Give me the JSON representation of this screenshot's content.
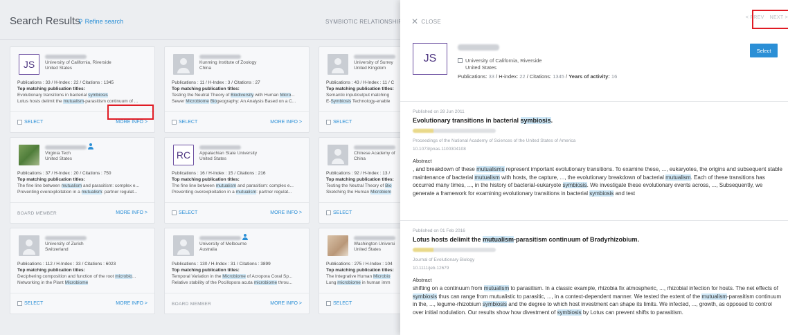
{
  "header": {
    "title": "Search Results",
    "refine": "Refine search",
    "breadcrumb": "SYMBIOTIC RELATIONSHIPS A"
  },
  "cards": [
    {
      "initials": "JS",
      "inst": "University of California, Riverside",
      "country": "United States",
      "stats": "Publications : 33 / H-Index : 22 / Citations : 1345",
      "tmpt": "Top matching publication titles:",
      "pub1": "Evolutionary transitions in bacterial symbiosis",
      "pub2": "Lotus hosts delimit the mutualism-parasitism continuum of ...",
      "select": "SELECT",
      "more": "MORE INFO >"
    },
    {
      "inst": "Kunming Institute of Zoology",
      "country": "China",
      "stats": "Publications : 11 / H-Index : 3 / Citations : 27",
      "tmpt": "Top matching publication titles:",
      "pub1": "Testing the Neutral Theory of Biodiversity with Human Micro...",
      "pub2": "Sewer Microbiome Biogeography: An Analysis Based on a C...",
      "select": "SELECT",
      "more": "MORE INFO >"
    },
    {
      "inst": "University of Surrey",
      "country": "United Kingdom",
      "stats": "Publications : 43 / H-Index : 11 / C",
      "tmpt": "Top matching publication titles:",
      "pub1": "Semantic input/output matching",
      "pub2": "E-Symbiosis Technology-enable",
      "select": "SELECT"
    },
    {
      "inst": "Virginia Tech",
      "country": "United States",
      "stats": "Publications : 37 / H-Index : 20 / Citations : 750",
      "tmpt": "Top matching publication titles:",
      "pub1": "The fine line between mutualism and parasitism: complex e...",
      "pub2": "Preventing overexploitation in a mutualism: partner regulat...",
      "board": "BOARD MEMBER",
      "more": "MORE INFO >"
    },
    {
      "initials": "RC",
      "inst": "Appalachian State University",
      "country": "United States",
      "stats": "Publications : 16 / H-Index : 15 / Citations : 216",
      "tmpt": "Top matching publication titles:",
      "pub1": "The fine line between mutualism and parasitism: complex e...",
      "pub2": "Preventing overexploitation in a mutualism: partner regulat...",
      "select": "SELECT",
      "more": "MORE INFO >"
    },
    {
      "inst": "Chinese Academy of",
      "country": "China",
      "stats": "Publications : 92 / H-Index : 13 /",
      "tmpt": "Top matching publication titles:",
      "pub1": "Testing the Neutral Theory of Bio",
      "pub2": "Sketching the Human Microbiom",
      "select": "SELECT"
    },
    {
      "inst": "University of Zurich",
      "country": "Switzerland",
      "stats": "Publications : 112 / H-Index : 33 / Citations : 6023",
      "tmpt": "Top matching publication titles:",
      "pub1": "Deciphering composition and function of the root microbio...",
      "pub2": "Networking in the Plant Microbiome",
      "select": "SELECT",
      "more": "MORE INFO >"
    },
    {
      "inst": "University of Melbourne",
      "country": "Australia",
      "stats": "Publications : 130 / H-Index : 31 / Citations : 3899",
      "tmpt": "Top matching publication titles:",
      "pub1": "Temporal Variation in the Microbiome of Acropora Coral Sp...",
      "pub2": "Relative stability of the Pocillopora acuta microbiome throu...",
      "board": "BOARD MEMBER",
      "more": "MORE INFO >"
    },
    {
      "inst": "Washington Universi",
      "country": "United States",
      "stats": "Publications : 275 / H-Index : 104",
      "tmpt": "Top matching publication titles:",
      "pub1": "The Integrative Human Microbio",
      "pub2": "Lung microbiome in human imm",
      "select": "SELECT"
    }
  ],
  "panel": {
    "close": "CLOSE",
    "prev": "< PREV",
    "next": "NEXT >",
    "initials": "JS",
    "inst": "University of California, Riverside",
    "country": "United States",
    "stats_pub_label": "Publications:",
    "stats_pub": "33",
    "stats_h_label": "H-index:",
    "stats_h": "22",
    "stats_c_label": "Citations:",
    "stats_c": "1345",
    "stats_y_label": "Years of activity:",
    "stats_y": "16",
    "select": "Select"
  },
  "articles": [
    {
      "date": "Published on 28 Jun 2011",
      "title_a": "Evolutionary transitions in bacterial ",
      "title_hl": "symbiosis",
      "title_b": ".",
      "journal": "Proceedings of the National Academy of Sciences of the United States of America",
      "doi": "10.1073/pnas.1100304108",
      "abs_label": "Abstract",
      "abstract": ", and breakdown of these mutualisms represent important evolutionary transitions. To examine these, ..., eukaryotes, the origins and subsequent stable maintenance of bacterial mutualism with hosts, the capture, ..., the evolutionary breakdown of bacterial mutualism. Each of these transitions has occurred many times, ..., in the history of bacterial-eukaryote symbiosis. We investigate these evolutionary events across, ..., Subsequently, we generate a framework for examining evolutionary transitions in bacterial symbiosis and test"
    },
    {
      "date": "Published on 01 Feb 2016",
      "title_a": "Lotus hosts delimit the ",
      "title_hl": "mutualism",
      "title_b": "-parasitism continuum of Bradyrhizobium.",
      "journal": "Journal of Evolutionary Biology",
      "doi": "10.1111/jeb.12679",
      "abs_label": "Abstract",
      "abstract": "shifting on a continuum from mutualism to parasitism. In a classic example, rhizobia fix atmospheric, ..., rhizobial infection for hosts. The net effects of symbiosis thus can range from mutualistic to parasitic, ..., in a context-dependent manner. We tested the extent of the mutualism-parasitism continuum in the, ..., legume-rhizobium symbiosis and the degree to which host investment can shape its limits. We infected, ..., growth, as opposed to control over initial nodulation. Our results show how divestment of symbiosis by Lotus can prevent shifts to parasitism."
    }
  ],
  "highlight_terms": [
    "symbiosis",
    "mutualisms",
    "mutualism",
    "Microbiome",
    "microbiome",
    "Biodiversity",
    "Micro",
    "Symbiosis",
    "microbio",
    "Bio",
    "Microbio",
    "Microbiom"
  ]
}
